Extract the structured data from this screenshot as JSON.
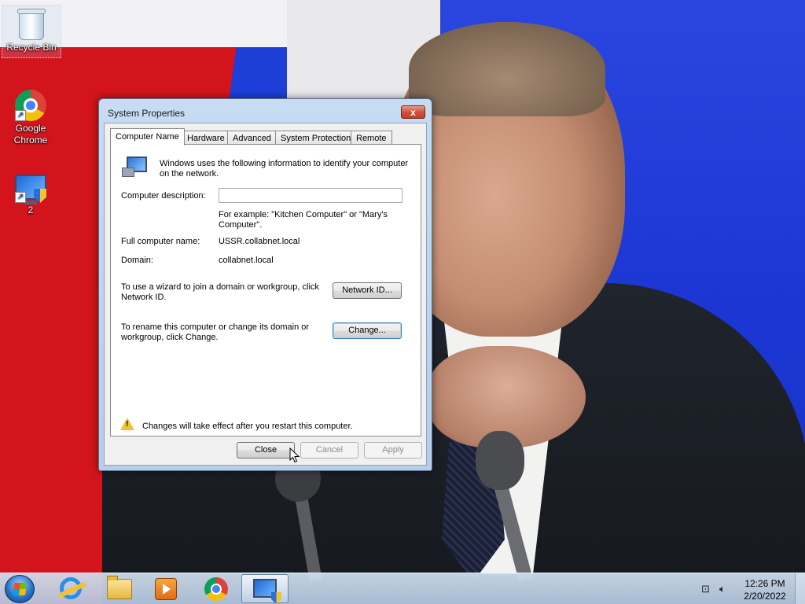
{
  "desktop": {
    "icons": [
      {
        "label": "Recycle Bin",
        "icon": "recycle-bin-icon"
      },
      {
        "label": "Google Chrome",
        "icon": "chrome-icon"
      },
      {
        "label": "2",
        "icon": "system-shortcut-icon"
      }
    ]
  },
  "dialog": {
    "title": "System Properties",
    "close_glyph": "x",
    "tabs": [
      {
        "label": "Computer Name",
        "active": true
      },
      {
        "label": "Hardware",
        "active": false
      },
      {
        "label": "Advanced",
        "active": false
      },
      {
        "label": "System Protection",
        "active": false
      },
      {
        "label": "Remote",
        "active": false
      }
    ],
    "intro_text": "Windows uses the following information to identify your computer on the network.",
    "computer_description": {
      "label": "Computer description:",
      "value": "",
      "example": "For example: \"Kitchen Computer\" or \"Mary's Computer\"."
    },
    "full_computer_name": {
      "label": "Full computer name:",
      "value": "USSR.collabnet.local"
    },
    "domain": {
      "label": "Domain:",
      "value": "collabnet.local"
    },
    "network_id": {
      "text": "To use a wizard to join a domain or workgroup, click Network ID.",
      "button": "Network ID..."
    },
    "change": {
      "text": "To rename this computer or change its domain or workgroup, click Change.",
      "button": "Change..."
    },
    "warning": "Changes will take effect after you restart this computer.",
    "buttons": {
      "close": "Close",
      "cancel": "Cancel",
      "apply": "Apply"
    }
  },
  "taskbar": {
    "pinned": [
      {
        "icon": "start-orb-icon"
      },
      {
        "icon": "internet-explorer-icon"
      },
      {
        "icon": "windows-explorer-icon"
      },
      {
        "icon": "media-player-icon"
      },
      {
        "icon": "chrome-icon"
      },
      {
        "icon": "system-properties-icon",
        "active": true
      }
    ],
    "clock": {
      "time": "12:26 PM",
      "date": "2/20/2022"
    }
  },
  "colors": {
    "wallpaper_blue": "#1d3fd8",
    "wallpaper_red": "#d3141c",
    "dialog_frame": "#b7cde8",
    "close_red": "#c33c26"
  }
}
